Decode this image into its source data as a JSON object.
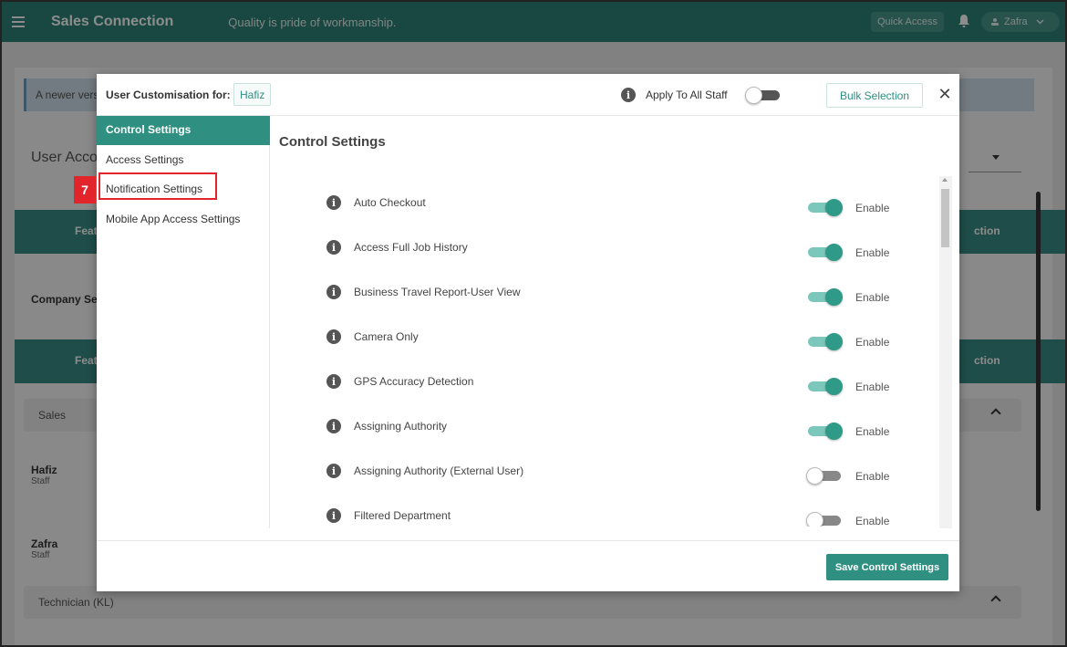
{
  "topbar": {
    "app_title": "Sales Connection",
    "tagline": "Quality is pride of workmanship.",
    "quick_access": "Quick Access",
    "user_name": "Zafra"
  },
  "background": {
    "banner_text": "A newer vers",
    "user_access_title": "User Acco",
    "header1_feature": "Feat",
    "header1_action": "ction",
    "company_label": "Company Se",
    "header2_feature": "Feat",
    "header2_action": "ction",
    "group_sales": "Sales",
    "staff": [
      {
        "name": "Hafiz",
        "role": "Staff"
      },
      {
        "name": "Zafra",
        "role": "Staff"
      }
    ],
    "group_technician": "Technician (KL)"
  },
  "modal": {
    "header_label": "User Customisation for:",
    "user": "Hafiz",
    "apply_all_label": "Apply To All Staff",
    "apply_all_on": false,
    "bulk_selection": "Bulk Selection",
    "nav": [
      {
        "label": "Control Settings",
        "active": true
      },
      {
        "label": "Access Settings",
        "active": false
      },
      {
        "label": "Notification Settings",
        "active": false
      },
      {
        "label": "Mobile App Access Settings",
        "active": false
      }
    ],
    "step_badge": "7",
    "content_title": "Control Settings",
    "settings": [
      {
        "label": "Auto Checkout",
        "on": true,
        "state": "Enable"
      },
      {
        "label": "Access Full Job History",
        "on": true,
        "state": "Enable"
      },
      {
        "label": "Business Travel Report-User View",
        "on": true,
        "state": "Enable"
      },
      {
        "label": "Camera Only",
        "on": true,
        "state": "Enable"
      },
      {
        "label": "GPS Accuracy Detection",
        "on": true,
        "state": "Enable"
      },
      {
        "label": "Assigning Authority",
        "on": true,
        "state": "Enable"
      },
      {
        "label": "Assigning Authority (External User)",
        "on": false,
        "state": "Enable"
      },
      {
        "label": "Filtered Department",
        "on": false,
        "state": "Enable"
      }
    ],
    "save_button": "Save Control Settings"
  },
  "colors": {
    "brand": "#2f8478",
    "accent": "#2f8f80",
    "highlight": "#e1252a"
  }
}
